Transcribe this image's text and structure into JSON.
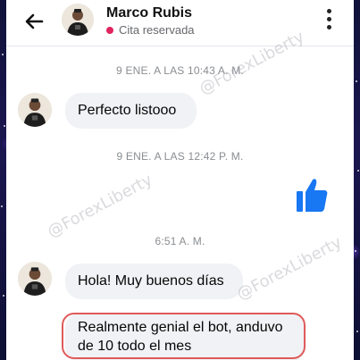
{
  "header": {
    "contact_name": "Marco Rubis",
    "status_text": "Cita reservada",
    "status_color": "#e0245e"
  },
  "icons": {
    "back": "arrow-left-icon",
    "more": "vertical-dots-icon",
    "like": "thumbs-up-icon"
  },
  "messages": {
    "timestamp_1": "9 ENE. A LAS 10:43 A. M.",
    "msg_1": "Perfecto listooo",
    "timestamp_2": "9 ENE. A LAS 12:42 P. M.",
    "timestamp_3": "6:51 A. M.",
    "msg_2": "Hola! Muy buenos días",
    "msg_3_line1": "Realmente genial el bot, anduvo",
    "msg_3_line2": "de 10 todo el mes"
  },
  "watermark": "@ForexLiberty",
  "colors": {
    "like_blue": "#1877f2",
    "highlight_red": "#e05a5a"
  }
}
